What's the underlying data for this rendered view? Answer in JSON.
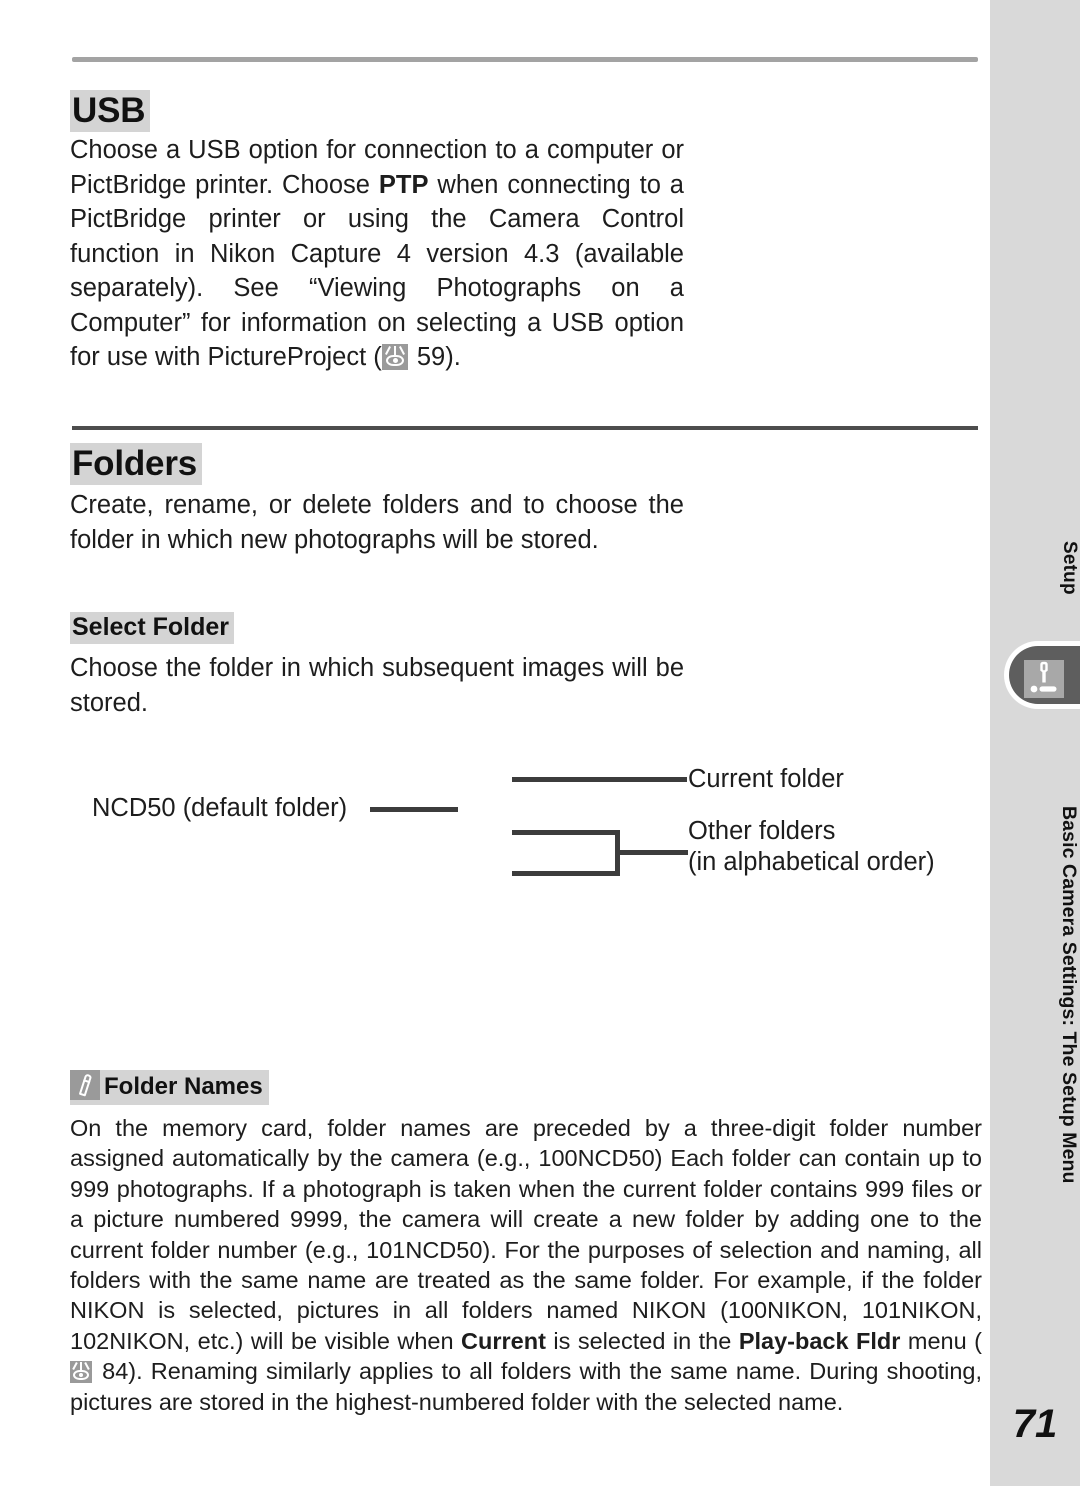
{
  "page": {
    "number": "71"
  },
  "side_tab": {
    "top_label": "Setup",
    "main_label": "Basic Camera Settings: The Setup Menu",
    "icon": "wrench-setup-icon",
    "strip_color": "#d9d9d9",
    "tab_color": "#5e5e5e"
  },
  "sections": {
    "usb": {
      "heading": "USB",
      "paragraph_part1": "Choose a USB option for connection to a computer or PictBridge printer.  Choose ",
      "bold1": "PTP",
      "paragraph_part2": " when connecting to a PictBridge printer or using the Camera Control function in Nikon Capture 4 version 4.3 (available separately).  See “Viewing Photographs on a Computer” for information on selecting a USB option for use with PictureProject (",
      "reference_icon": "see-reference-eye-icon",
      "reference_page": " 59)."
    },
    "folders": {
      "heading": "Folders",
      "paragraph": "Create, rename, or delete folders and to choose the folder in which new photographs will be stored."
    },
    "select_folder": {
      "heading": "Select Folder",
      "paragraph": "Choose the folder in which subsequent images will be stored."
    }
  },
  "diagram": {
    "label_default_folder": "NCD50 (default folder)",
    "label_current_folder": "Current folder",
    "label_other_folders_line1": "Other folders",
    "label_other_folders_line2": "(in alphabetical order)",
    "line_color": "#3c3c3c"
  },
  "note": {
    "icon": "pencil-note-icon",
    "heading": "Folder Names",
    "text_part1": "On the memory card, folder names are preceded by a three-digit folder number assigned automatically by the camera (e.g., 100NCD50)  Each folder can contain up to 999 photographs.  If a photograph is taken when the current folder contains 999 files or a picture numbered 9999, the camera will create a new folder by adding one to the current folder number (e.g., 101NCD50).  For the purposes of selection and naming, all folders with the same name are treated as the same folder.  For example, if the folder NIKON is selected, pictures in all folders named NIKON (100NIKON, 101NIKON, 102NIKON, etc.) will be visible when ",
    "bold_current": "Current",
    "text_part2": " is selected in the ",
    "bold_playback": "Play-back Fldr",
    "text_part3": " menu (",
    "reference_icon": "see-reference-eye-icon",
    "text_part4": " 84).  Renaming similarly applies to all folders with the same name.  During shooting, pictures are stored in the highest-numbered folder with the selected name."
  }
}
